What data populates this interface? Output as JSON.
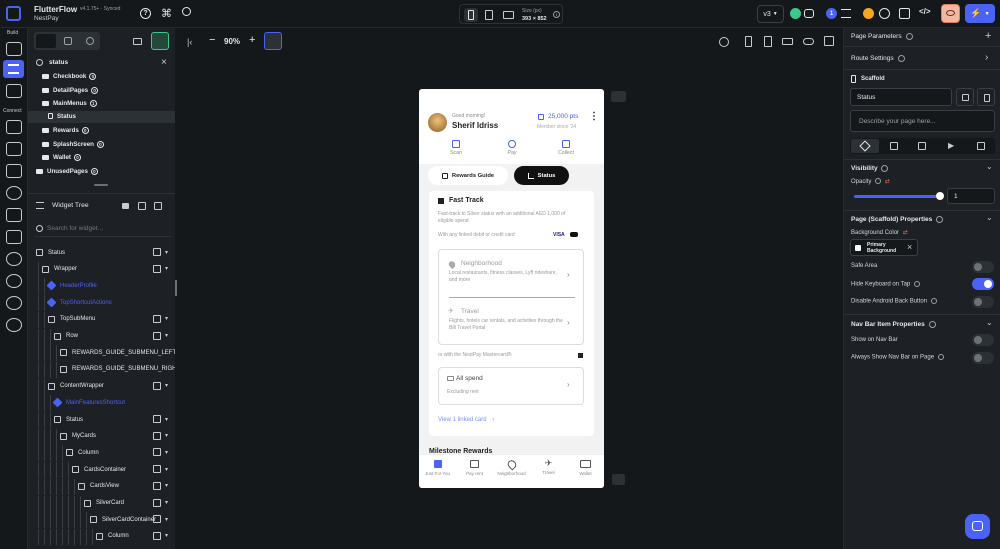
{
  "app": {
    "name": "FlutterFlow",
    "version": "v4.1.75+ · Synced",
    "project": "NestPay"
  },
  "topbar": {
    "size_label": "Size (px)",
    "size_value": "393 × 852",
    "version_select": "v3",
    "notif_count": "1",
    "zoom": "90%"
  },
  "rail": {
    "build_label": "Build",
    "connect_label": "Connect"
  },
  "search": {
    "value": "status"
  },
  "page_tree": [
    {
      "label": "Checkbook",
      "badge": "0",
      "indent": 1,
      "type": "folder"
    },
    {
      "label": "DetailPages",
      "badge": "0",
      "indent": 1,
      "type": "folder"
    },
    {
      "label": "MainMenus",
      "badge": "1",
      "indent": 1,
      "type": "folder"
    },
    {
      "label": "Status",
      "badge": "",
      "indent": 2,
      "type": "page",
      "selected": true
    },
    {
      "label": "Rewards",
      "badge": "0",
      "indent": 1,
      "type": "folder"
    },
    {
      "label": "SplashScreen",
      "badge": "0",
      "indent": 1,
      "type": "folder"
    },
    {
      "label": "Wallet",
      "badge": "0",
      "indent": 1,
      "type": "folder"
    },
    {
      "label": "UnusedPages",
      "badge": "0",
      "indent": 0,
      "type": "folder"
    }
  ],
  "widget_tree": {
    "title": "Widget Tree",
    "search_placeholder": "Search for widget...",
    "rows": [
      {
        "label": "Status",
        "indent": 0,
        "style": "plain",
        "ctl": true
      },
      {
        "label": "Wrapper",
        "indent": 1,
        "style": "plain",
        "ctl": true
      },
      {
        "label": "HeaderProfile",
        "indent": 2,
        "style": "blue",
        "ctl": false
      },
      {
        "label": "TopShortcutActions",
        "indent": 2,
        "style": "blue",
        "ctl": false
      },
      {
        "label": "TopSubMenu",
        "indent": 2,
        "style": "plain",
        "ctl": true
      },
      {
        "label": "Row",
        "indent": 3,
        "style": "plain",
        "ctl": true
      },
      {
        "label": "REWARDS_GUIDE_SUBMENU_LEFT",
        "indent": 4,
        "style": "plain",
        "ctl": false
      },
      {
        "label": "REWARDS_GUIDE_SUBMENU_RIGHT",
        "indent": 4,
        "style": "plain",
        "ctl": false
      },
      {
        "label": "ContentWrapper",
        "indent": 2,
        "style": "plain",
        "ctl": true
      },
      {
        "label": "MainFeaturesShortcut",
        "indent": 3,
        "style": "blue",
        "ctl": false
      },
      {
        "label": "Status",
        "indent": 3,
        "style": "plain",
        "ctl": true
      },
      {
        "label": "MyCards",
        "indent": 4,
        "style": "plain",
        "ctl": true
      },
      {
        "label": "Column",
        "indent": 5,
        "style": "plain",
        "ctl": true
      },
      {
        "label": "CardsContainer",
        "indent": 6,
        "style": "plain",
        "ctl": true
      },
      {
        "label": "CardsView",
        "indent": 7,
        "style": "plain",
        "ctl": true
      },
      {
        "label": "SilverCard",
        "indent": 8,
        "style": "plain",
        "ctl": true
      },
      {
        "label": "SilverCardContainer",
        "indent": 9,
        "style": "plain",
        "ctl": true
      },
      {
        "label": "Column",
        "indent": 10,
        "style": "plain",
        "ctl": true
      }
    ]
  },
  "phone": {
    "greeting": "Good morning!",
    "user": "Sherif Idriss",
    "points": "25,000 pts",
    "member_since": "Member since '24",
    "actions": [
      "Scan",
      "Pay",
      "Collect"
    ],
    "tab_left": "Rewards Guide",
    "tab_right": "Status",
    "section_title": "Fast Track",
    "section_desc": "Fast-track to Silver status with an additional AED 1,000 of eligible spend",
    "linked_line": "With any linked debit or credit card",
    "visa": "VISA",
    "opt1_title": "Neighborhood",
    "opt1_desc": "Local restaurants, fitness classes, Lyft rideshare, and more",
    "opt2_title": "Travel",
    "opt2_desc": "Flights, hotels car rentals, and activities through the Bilt Travel Portal",
    "mastercard_line": "or with the NestPay Mastercard®",
    "opt3_title": "All spend",
    "opt3_desc": "Excluding rent",
    "view_link": "View 1 linked card",
    "milestone": "Milestone Rewards",
    "nav": [
      "Just For You",
      "Pay rent",
      "Neighborhood",
      "Travel",
      "Wallet"
    ]
  },
  "panel": {
    "page_params": "Page Parameters",
    "route": "Route Settings",
    "scaffold": "Scaffold",
    "name_value": "Status",
    "desc_placeholder": "Describe your page here...",
    "visibility": "Visibility",
    "opacity_label": "Opacity",
    "opacity_value": "1",
    "opacity": 1,
    "props_title": "Page (Scaffold) Properties",
    "bg_label": "Background Color",
    "bg_value": "Primary Background",
    "safe_area": "Safe Area",
    "safe_area_on": false,
    "hide_kb": "Hide Keyboard on Tap",
    "hide_kb_on": true,
    "disable_back": "Disable Android Back Button",
    "disable_back_on": false,
    "nav_title": "Nav Bar Item Properties",
    "show_nav": "Show on Nav Bar",
    "show_nav_on": false,
    "always_show": "Always Show Nav Bar on Page",
    "always_show_on": false
  },
  "colors": {
    "accent": "#4b62f7",
    "bg": "#14181b",
    "panel": "#1d2125"
  }
}
